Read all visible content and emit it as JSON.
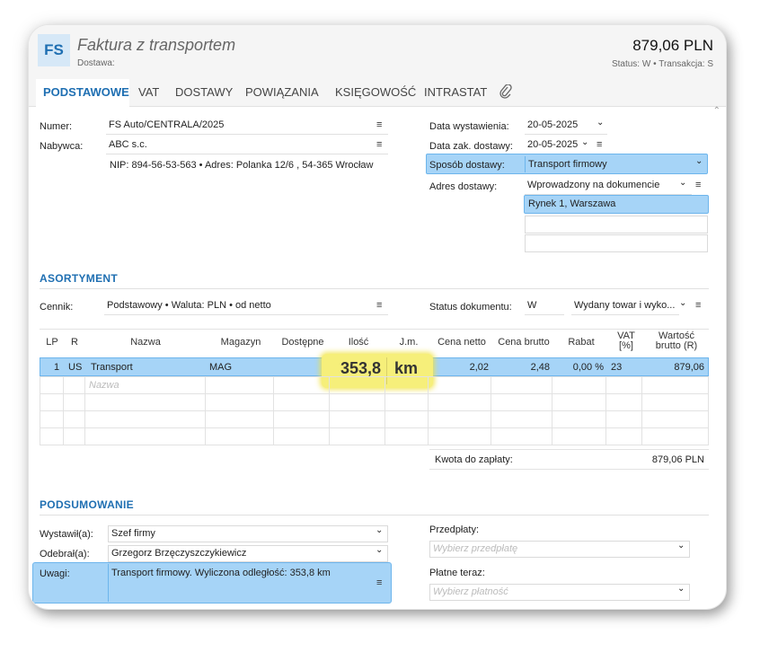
{
  "header": {
    "badge": "FS",
    "title": "Faktura z transportem",
    "subtitle": "Dostawa:",
    "amount": "879,06 PLN",
    "status_label": "Status:",
    "status_value": "W",
    "sep": "•",
    "trans_label": "Transakcja:",
    "trans_value": "S"
  },
  "tabs": [
    "PODSTAWOWE",
    "VAT",
    "DOSTAWY",
    "POWIĄZANIA",
    "KSIĘGOWOŚĆ",
    "INTRASTAT"
  ],
  "form": {
    "numer_label": "Numer:",
    "numer_value": "FS Auto/CENTRALA/2025",
    "nabywca_label": "Nabywca:",
    "nabywca_value": "ABC s.c.",
    "nip_line": "NIP:  894-56-53-563  •  Adres:  Polanka  12/6 , 54-365 Wrocław",
    "data_wyst_label": "Data wystawienia:",
    "data_wyst_value": "20-05-2025",
    "data_zak_label": "Data zak. dostawy:",
    "data_zak_value": "20-05-2025",
    "sposob_label": "Sposób dostawy:",
    "sposob_value": "Transport firmowy",
    "adres_label": "Adres dostawy:",
    "adres_value": "Wprowadzony na dokumencie",
    "adres_line1": "Rynek 1, Warszawa"
  },
  "asortyment": {
    "title": "ASORTYMENT",
    "cennik_label": "Cennik:",
    "cennik_value": "Podstawowy • Waluta: PLN • od netto",
    "status_dok_label": "Status dokumentu:",
    "status_dok_code": "W",
    "status_dok_value": "Wydany towar i wyko...",
    "columns": [
      "LP",
      "R",
      "Nazwa",
      "Magazyn",
      "Dostępne",
      "Ilość",
      "J.m.",
      "Cena netto",
      "Cena brutto",
      "Rabat",
      "VAT [%]",
      "Wartość brutto (R)"
    ],
    "vat_col_l1": "VAT",
    "vat_col_l2": "[%]",
    "wart_col_l1": "Wartość",
    "wart_col_l2": "brutto (R)",
    "row": {
      "lp": "1",
      "r": "US",
      "nazwa": "Transport",
      "magazyn": "MAG",
      "dostepne": "",
      "ilosc": "353,8",
      "jm": "km",
      "cena_netto": "2,02",
      "cena_brutto": "2,48",
      "rabat": "0,00 %",
      "vat": "23",
      "wartosc": "879,06"
    },
    "new_row_placeholder": "Nazwa",
    "kwota_label": "Kwota do zapłaty:",
    "kwota_value": "879,06 PLN"
  },
  "podsumowanie": {
    "title": "PODSUMOWANIE",
    "wystawil_label": "Wystawił(a):",
    "wystawil_value": "Szef firmy",
    "odebral_label": "Odebrał(a):",
    "odebral_value": "Grzegorz Brzęczyszczykiewicz",
    "uwagi_label": "Uwagi:",
    "uwagi_value": "Transport firmowy. Wyliczona odległość: 353,8 km",
    "przedplaty_label": "Przedpłaty:",
    "przedplaty_placeholder": "Wybierz przedpłatę",
    "platne_label": "Płatne teraz:",
    "platne_placeholder": "Wybierz płatność"
  },
  "icons": {
    "menu": "≡",
    "chevron": "⌄",
    "attach": "paperclip-icon"
  }
}
